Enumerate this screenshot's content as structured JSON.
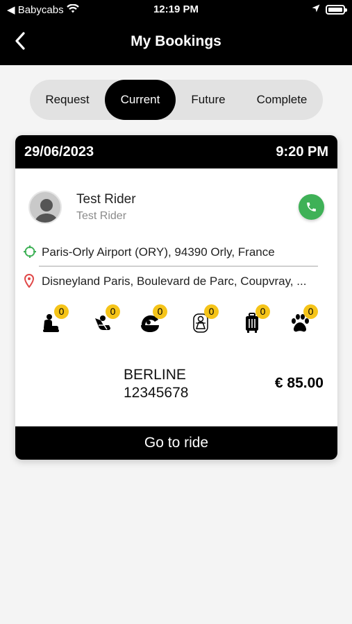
{
  "status_bar": {
    "carrier": "◀ Babycabs",
    "time": "12:19 PM",
    "battery_level": 0.95
  },
  "header": {
    "title": "My Bookings"
  },
  "tabs": [
    {
      "label": "Request"
    },
    {
      "label": "Current"
    },
    {
      "label": "Future"
    },
    {
      "label": "Complete"
    }
  ],
  "active_tab": "Current",
  "booking": {
    "date": "29/06/2023",
    "time": "9:20 PM",
    "rider": {
      "name": "Test Rider",
      "subtitle": "Test Rider"
    },
    "pickup": "Paris-Orly Airport (ORY), 94390 Orly, France",
    "dropoff": "Disneyland Paris, Boulevard de Parc, Coupvray, ...",
    "amenities": [
      {
        "icon": "booster-seat-icon",
        "count": "0"
      },
      {
        "icon": "child-seat-icon",
        "count": "0"
      },
      {
        "icon": "infant-carrier-icon",
        "count": "0"
      },
      {
        "icon": "car-seat-baby-icon",
        "count": "0"
      },
      {
        "icon": "luggage-icon",
        "count": "0"
      },
      {
        "icon": "pet-paw-icon",
        "count": "0"
      }
    ],
    "vehicle": {
      "type": "BERLINE",
      "number": "12345678"
    },
    "price": "€ 85.00",
    "action_label": "Go to ride"
  },
  "colors": {
    "accent_call": "#3fb157",
    "badge": "#f5c419",
    "pickup_icon": "#3fb157",
    "dropoff_icon": "#e04848"
  }
}
